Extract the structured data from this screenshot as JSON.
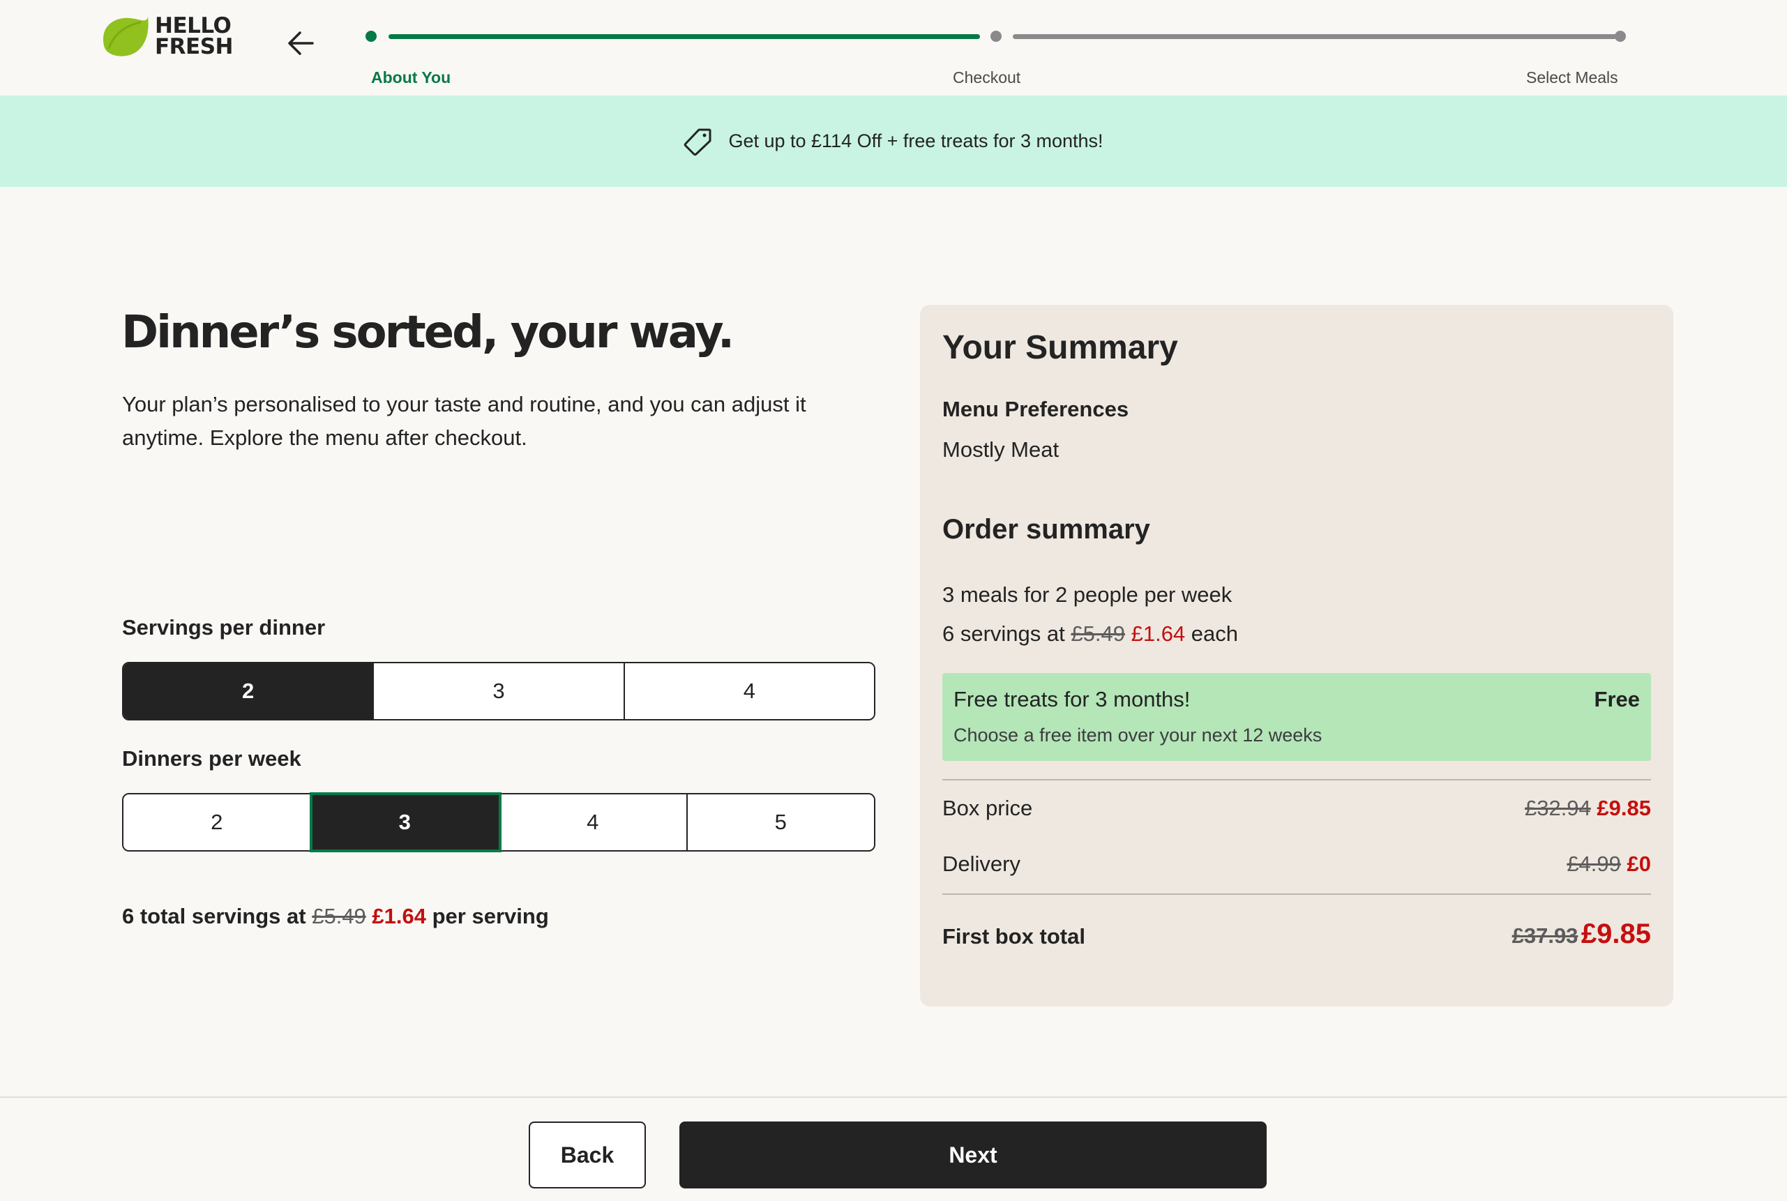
{
  "brand": {
    "logo_line1": "HELLO",
    "logo_line2": "FRESH"
  },
  "progress": {
    "steps": [
      {
        "label": "About You",
        "state": "active"
      },
      {
        "label": "Checkout",
        "state": "inactive"
      },
      {
        "label": "Select Meals",
        "state": "inactive"
      }
    ]
  },
  "promo": {
    "text": "Get up to £114 Off + free treats for 3 months!",
    "icon": "tag-icon"
  },
  "main": {
    "title": "Dinner’s sorted, your way.",
    "subtitle": "Your plan’s personalised to your taste and routine, and you can adjust it anytime. Explore the menu after checkout.",
    "servings": {
      "label": "Servings per dinner",
      "options": [
        "2",
        "3",
        "4"
      ],
      "selected": "2"
    },
    "dinners": {
      "label": "Dinners per week",
      "options": [
        "2",
        "3",
        "4",
        "5"
      ],
      "selected": "3"
    },
    "total": {
      "prefix": "6 total servings at",
      "old_price": "£5.49",
      "new_price": "£1.64",
      "suffix": "per serving"
    }
  },
  "summary": {
    "title": "Your Summary",
    "menu_pref_label": "Menu Preferences",
    "menu_pref_value": "Mostly Meat",
    "order_title": "Order summary",
    "meals_line": "3 meals for 2 people per week",
    "servings_prefix": "6 servings at",
    "servings_old": "£5.49",
    "servings_new": "£1.64",
    "servings_suffix": "each",
    "treat": {
      "title": "Free treats for 3 months!",
      "badge": "Free",
      "subtitle": "Choose a free item over your next 12 weeks"
    },
    "box_price": {
      "label": "Box price",
      "old": "£32.94",
      "new": "£9.85"
    },
    "delivery": {
      "label": "Delivery",
      "old": "£4.99",
      "new": "£0"
    },
    "first_box": {
      "label": "First box total",
      "old": "£37.93",
      "new": "£9.85"
    }
  },
  "footer": {
    "back_label": "Back",
    "next_label": "Next"
  },
  "colors": {
    "brand_green": "#067a46",
    "promo_bg": "#c9f4e3",
    "price_red": "#c40f0f",
    "summary_bg": "#efe8e0",
    "treat_bg": "#b4e6b8"
  }
}
